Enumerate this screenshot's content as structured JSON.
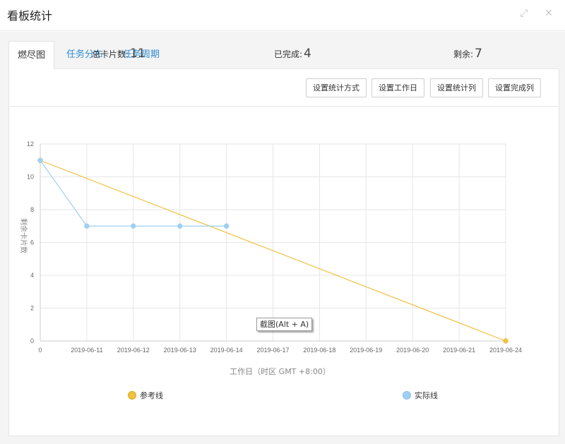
{
  "window": {
    "title": "看板统计"
  },
  "tabs": [
    {
      "label": "燃尽图",
      "active": true
    },
    {
      "label": "任务分布",
      "active": false
    },
    {
      "label": "任务周期",
      "active": false
    }
  ],
  "toolbar": {
    "buttons": [
      "设置统计方式",
      "设置工作日",
      "设置统计列",
      "设置完成列"
    ]
  },
  "stats": {
    "total_label": "总卡片数:",
    "total_value": "11",
    "done_label": "已完成:",
    "done_value": "4",
    "remaining_label": "剩余:",
    "remaining_value": "7"
  },
  "tooltip": {
    "text": "截图(Alt + A)"
  },
  "colors": {
    "reference_line": "#f0c040",
    "actual_line": "#9fd0f2",
    "tab_link": "#2e8bd0",
    "grid": "#e6e6e6"
  },
  "chart_data": {
    "type": "line",
    "categories": [
      "0",
      "2019-06-11",
      "2019-06-12",
      "2019-06-13",
      "2019-06-14",
      "2019-06-17",
      "2019-06-18",
      "2019-06-19",
      "2019-06-20",
      "2019-06-21",
      "2019-06-24"
    ],
    "xlabel": "工作日（时区 GMT +8:00）",
    "ylabel": "剩余卡片数",
    "ylim": [
      0,
      12
    ],
    "yticks": [
      0,
      2,
      4,
      6,
      8,
      10,
      12
    ],
    "grid": true,
    "legend_position": "bottom",
    "series": [
      {
        "name": "参考线",
        "values": [
          11,
          null,
          null,
          null,
          null,
          null,
          null,
          null,
          null,
          null,
          0
        ],
        "color": "#f0c040"
      },
      {
        "name": "实际线",
        "values": [
          11,
          7,
          7,
          7,
          7,
          null,
          null,
          null,
          null,
          null,
          null
        ],
        "color": "#9fd0f2"
      }
    ]
  }
}
